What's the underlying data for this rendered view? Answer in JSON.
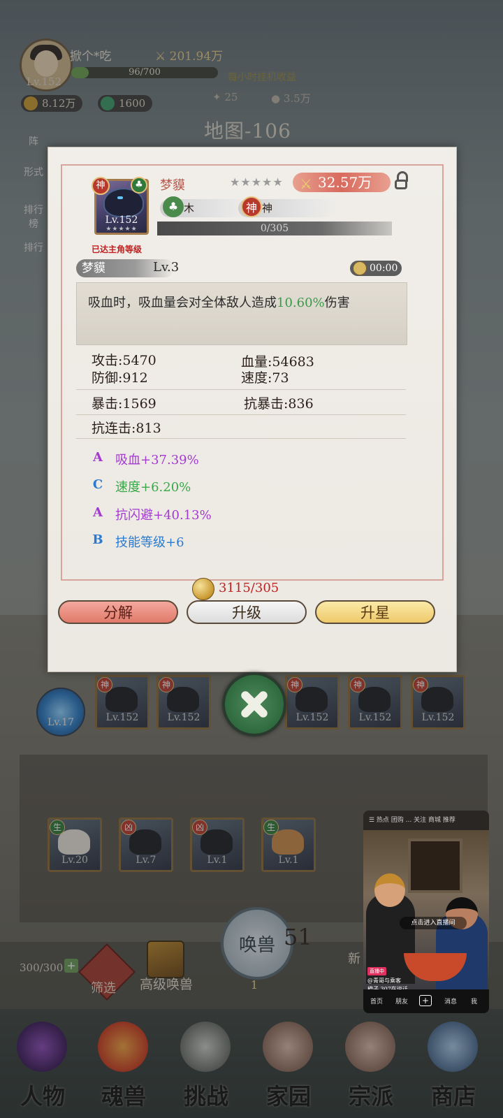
{
  "player": {
    "name": "掀个*吃",
    "level": "Lv.152",
    "power": "201.94万",
    "exp_text": "96/700",
    "exp_fraction": 0.137,
    "coins": "8.12万",
    "jade": "1600",
    "hourly_label": "每小时挂机收益",
    "hourly_a": "25",
    "hourly_b": "3.5万"
  },
  "map_title": "地图-106",
  "side_buttons": [
    "阵",
    "形式",
    "排行榜",
    "排行"
  ],
  "popup": {
    "pet_name": "梦貘",
    "card_level": "Lv.152",
    "card_tag": "神",
    "stars": "★★★★★",
    "power": "32.57万",
    "element_1": "木",
    "element_2": "神",
    "xp_text": "0/305",
    "level_note": "已达主角等级",
    "skill_name": "梦貘",
    "skill_level": "Lv.3",
    "timer": "00:00",
    "desc_prefix": "吸血时，吸血量会对全体敌人造成",
    "desc_highlight": "10.60%",
    "desc_suffix": "伤害",
    "stats": {
      "attack": "攻击:5470",
      "hp": "血量:54683",
      "defense": "防御:912",
      "speed": "速度:73",
      "crit": "暴击:1569",
      "anti_crit": "抗暴击:836",
      "anti_combo": "抗连击:813"
    },
    "attributes": [
      {
        "grade": "A",
        "text": "吸血+37.39%",
        "color": "#a23ad0"
      },
      {
        "grade": "C",
        "text": "速度+6.20%",
        "color": "#38a848"
      },
      {
        "grade": "A",
        "text": "抗闪避+40.13%",
        "color": "#a23ad0"
      },
      {
        "grade": "B",
        "text": "技能等级+6",
        "color": "#2a7ad0"
      }
    ],
    "cost": "3115/305",
    "buttons": {
      "decompose": "分解",
      "upgrade": "升级",
      "star_up": "升星"
    }
  },
  "roster": {
    "orb_level": "Lv.17",
    "top_row": [
      {
        "tag": "神",
        "level": "Lv.152"
      },
      {
        "tag": "神",
        "level": "Lv.152"
      },
      {
        "tag": "神",
        "level": "Lv.152"
      },
      {
        "tag": "神",
        "level": "Lv.152"
      },
      {
        "tag": "神",
        "level": "Lv.152"
      }
    ],
    "grid_row": [
      {
        "tag": "生",
        "level": "Lv.20"
      },
      {
        "tag": "凶",
        "level": "Lv.7"
      },
      {
        "tag": "凶",
        "level": "Lv.1"
      },
      {
        "tag": "生",
        "level": "Lv.1"
      }
    ],
    "capacity": "300/300",
    "filter_label": "筛选",
    "high_summon_label": "高级唤兽",
    "summon_label": "唤兽",
    "summon_count": "51",
    "summon_sub": "1",
    "new_label": "新"
  },
  "video": {
    "top_tabs": "☰  热点  团购  ...  关注  商城  推荐",
    "live_text": "点击进入直播间",
    "tag": "直播中",
    "caption_line1": "@青哥与乘客",
    "caption_line2": "橙子 307在说话",
    "nav": [
      "首页",
      "朋友",
      "消息",
      "我"
    ]
  },
  "nav": [
    {
      "label": "人物",
      "color": "#5a2a7a"
    },
    {
      "label": "魂兽",
      "color": "#c8502a"
    },
    {
      "label": "挑战",
      "color": "#6a6e6a"
    },
    {
      "label": "家园",
      "color": "#8a6a5a"
    },
    {
      "label": "宗派",
      "color": "#8a6a5a"
    },
    {
      "label": "商店",
      "color": "#5a7aa0"
    }
  ]
}
